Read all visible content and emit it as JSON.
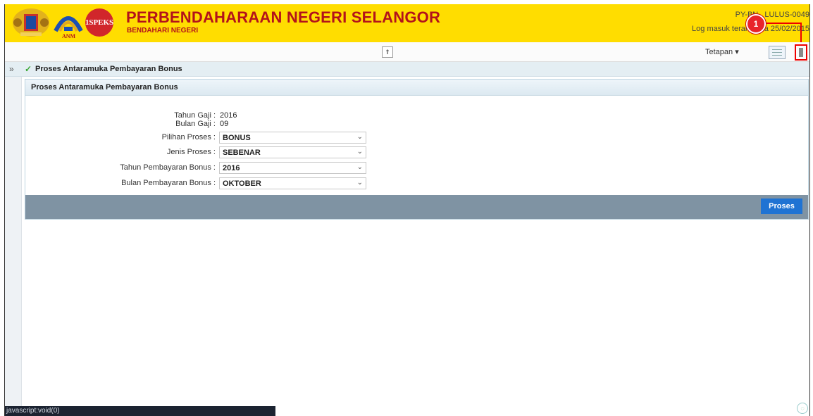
{
  "header": {
    "logo_text": "1SPEKS",
    "anm_text": "ANM",
    "title": "PERBENDAHARAAN NEGERI SELANGOR",
    "subtitle": "BENDAHARI NEGERI",
    "user_id": "PY-BN . LULUS-0049",
    "last_login": "Log masuk terakhir , a 25/02/2015",
    "callout": "1"
  },
  "toolbar": {
    "collapse_symbol": "⇑",
    "settings_label": "Tetapan ▾"
  },
  "breadcrumb": {
    "expand_symbol": "»",
    "check_symbol": "✓",
    "title": "Proses Antaramuka Pembayaran Bonus"
  },
  "panel": {
    "title": "Proses Antaramuka Pembayaran Bonus",
    "fields": {
      "tahun_gaji": {
        "label": "Tahun Gaji :",
        "value": "2016"
      },
      "bulan_gaji": {
        "label": "Bulan Gaji :",
        "value": "09"
      },
      "pilihan_proses": {
        "label": "Pilihan Proses :",
        "value": "BONUS"
      },
      "jenis_proses": {
        "label": "Jenis Proses :",
        "value": "SEBENAR"
      },
      "tahun_pembayaran": {
        "label": "Tahun Pembayaran Bonus :",
        "value": "2016"
      },
      "bulan_pembayaran": {
        "label": "Bulan Pembayaran Bonus :",
        "value": "OKTOBER"
      }
    },
    "submit_label": "Proses"
  },
  "status_bar": {
    "text": "javascript:void(0)"
  },
  "colors": {
    "header_bg": "#ffdd00",
    "title_red": "#b3121b",
    "primary_button": "#1f73d3",
    "callout_red": "#e8242b"
  },
  "icons": {
    "crest": "coat-of-arms-icon",
    "exit": "logout-icon",
    "list": "list-view-icon",
    "help": "help-icon",
    "check": "check-icon"
  }
}
